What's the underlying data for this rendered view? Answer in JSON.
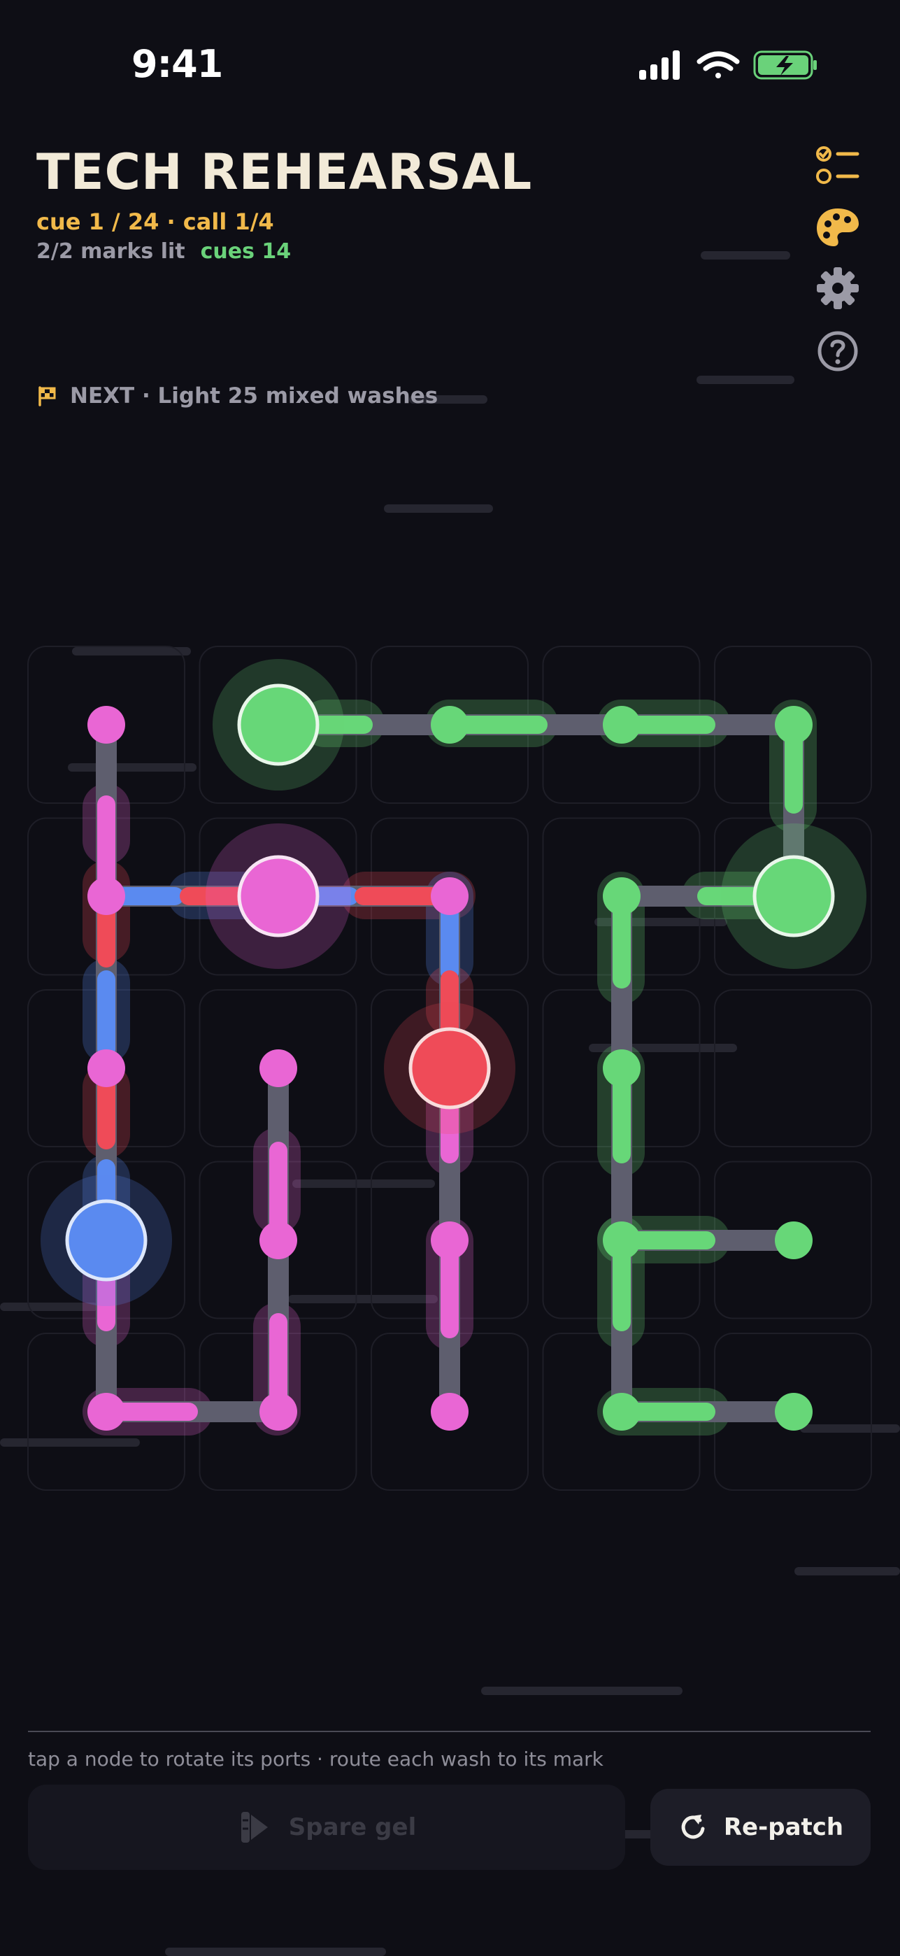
{
  "status_bar": {
    "time": "9:41"
  },
  "header": {
    "title": "TECH REHEARSAL",
    "cue_line": "cue 1 / 24 · call 1/4",
    "marks_lit": "2/2 marks lit",
    "cues": "cues 14"
  },
  "side_icons": [
    "checklist-icon",
    "palette-icon",
    "gear-icon",
    "help-icon"
  ],
  "next": {
    "icon": "flag-icon",
    "label": "NEXT · Light 25 mixed washes"
  },
  "colors": {
    "pink": "#e966d4",
    "green": "#67d778",
    "blue": "#5a8af0",
    "red": "#ef4b58",
    "wire": "#5e5e6e",
    "accent": "#f1b94a"
  },
  "board": {
    "rows": 5,
    "cols": 5
  },
  "footer": {
    "hint": "tap a node to rotate its ports · route each wash to its mark",
    "spare_label": "Spare gel",
    "repatch_label": "Re-patch"
  }
}
